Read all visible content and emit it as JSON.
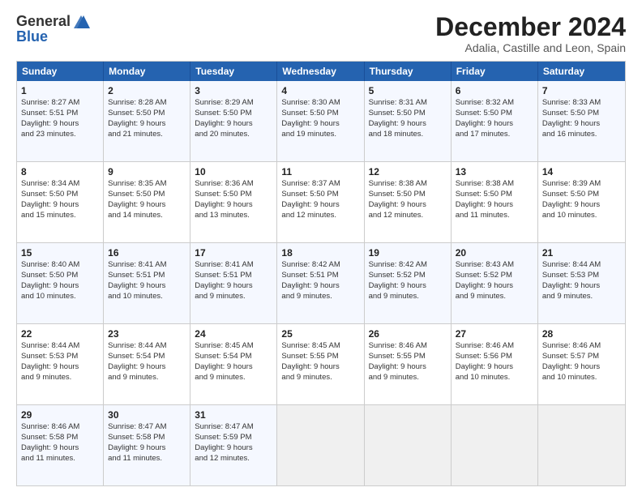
{
  "logo": {
    "general": "General",
    "blue": "Blue"
  },
  "title": "December 2024",
  "subtitle": "Adalia, Castille and Leon, Spain",
  "header_days": [
    "Sunday",
    "Monday",
    "Tuesday",
    "Wednesday",
    "Thursday",
    "Friday",
    "Saturday"
  ],
  "weeks": [
    [
      {
        "day": "1",
        "lines": [
          "Sunrise: 8:27 AM",
          "Sunset: 5:51 PM",
          "Daylight: 9 hours",
          "and 23 minutes."
        ]
      },
      {
        "day": "2",
        "lines": [
          "Sunrise: 8:28 AM",
          "Sunset: 5:50 PM",
          "Daylight: 9 hours",
          "and 21 minutes."
        ]
      },
      {
        "day": "3",
        "lines": [
          "Sunrise: 8:29 AM",
          "Sunset: 5:50 PM",
          "Daylight: 9 hours",
          "and 20 minutes."
        ]
      },
      {
        "day": "4",
        "lines": [
          "Sunrise: 8:30 AM",
          "Sunset: 5:50 PM",
          "Daylight: 9 hours",
          "and 19 minutes."
        ]
      },
      {
        "day": "5",
        "lines": [
          "Sunrise: 8:31 AM",
          "Sunset: 5:50 PM",
          "Daylight: 9 hours",
          "and 18 minutes."
        ]
      },
      {
        "day": "6",
        "lines": [
          "Sunrise: 8:32 AM",
          "Sunset: 5:50 PM",
          "Daylight: 9 hours",
          "and 17 minutes."
        ]
      },
      {
        "day": "7",
        "lines": [
          "Sunrise: 8:33 AM",
          "Sunset: 5:50 PM",
          "Daylight: 9 hours",
          "and 16 minutes."
        ]
      }
    ],
    [
      {
        "day": "8",
        "lines": [
          "Sunrise: 8:34 AM",
          "Sunset: 5:50 PM",
          "Daylight: 9 hours",
          "and 15 minutes."
        ]
      },
      {
        "day": "9",
        "lines": [
          "Sunrise: 8:35 AM",
          "Sunset: 5:50 PM",
          "Daylight: 9 hours",
          "and 14 minutes."
        ]
      },
      {
        "day": "10",
        "lines": [
          "Sunrise: 8:36 AM",
          "Sunset: 5:50 PM",
          "Daylight: 9 hours",
          "and 13 minutes."
        ]
      },
      {
        "day": "11",
        "lines": [
          "Sunrise: 8:37 AM",
          "Sunset: 5:50 PM",
          "Daylight: 9 hours",
          "and 12 minutes."
        ]
      },
      {
        "day": "12",
        "lines": [
          "Sunrise: 8:38 AM",
          "Sunset: 5:50 PM",
          "Daylight: 9 hours",
          "and 12 minutes."
        ]
      },
      {
        "day": "13",
        "lines": [
          "Sunrise: 8:38 AM",
          "Sunset: 5:50 PM",
          "Daylight: 9 hours",
          "and 11 minutes."
        ]
      },
      {
        "day": "14",
        "lines": [
          "Sunrise: 8:39 AM",
          "Sunset: 5:50 PM",
          "Daylight: 9 hours",
          "and 10 minutes."
        ]
      }
    ],
    [
      {
        "day": "15",
        "lines": [
          "Sunrise: 8:40 AM",
          "Sunset: 5:50 PM",
          "Daylight: 9 hours",
          "and 10 minutes."
        ]
      },
      {
        "day": "16",
        "lines": [
          "Sunrise: 8:41 AM",
          "Sunset: 5:51 PM",
          "Daylight: 9 hours",
          "and 10 minutes."
        ]
      },
      {
        "day": "17",
        "lines": [
          "Sunrise: 8:41 AM",
          "Sunset: 5:51 PM",
          "Daylight: 9 hours",
          "and 9 minutes."
        ]
      },
      {
        "day": "18",
        "lines": [
          "Sunrise: 8:42 AM",
          "Sunset: 5:51 PM",
          "Daylight: 9 hours",
          "and 9 minutes."
        ]
      },
      {
        "day": "19",
        "lines": [
          "Sunrise: 8:42 AM",
          "Sunset: 5:52 PM",
          "Daylight: 9 hours",
          "and 9 minutes."
        ]
      },
      {
        "day": "20",
        "lines": [
          "Sunrise: 8:43 AM",
          "Sunset: 5:52 PM",
          "Daylight: 9 hours",
          "and 9 minutes."
        ]
      },
      {
        "day": "21",
        "lines": [
          "Sunrise: 8:44 AM",
          "Sunset: 5:53 PM",
          "Daylight: 9 hours",
          "and 9 minutes."
        ]
      }
    ],
    [
      {
        "day": "22",
        "lines": [
          "Sunrise: 8:44 AM",
          "Sunset: 5:53 PM",
          "Daylight: 9 hours",
          "and 9 minutes."
        ]
      },
      {
        "day": "23",
        "lines": [
          "Sunrise: 8:44 AM",
          "Sunset: 5:54 PM",
          "Daylight: 9 hours",
          "and 9 minutes."
        ]
      },
      {
        "day": "24",
        "lines": [
          "Sunrise: 8:45 AM",
          "Sunset: 5:54 PM",
          "Daylight: 9 hours",
          "and 9 minutes."
        ]
      },
      {
        "day": "25",
        "lines": [
          "Sunrise: 8:45 AM",
          "Sunset: 5:55 PM",
          "Daylight: 9 hours",
          "and 9 minutes."
        ]
      },
      {
        "day": "26",
        "lines": [
          "Sunrise: 8:46 AM",
          "Sunset: 5:55 PM",
          "Daylight: 9 hours",
          "and 9 minutes."
        ]
      },
      {
        "day": "27",
        "lines": [
          "Sunrise: 8:46 AM",
          "Sunset: 5:56 PM",
          "Daylight: 9 hours",
          "and 10 minutes."
        ]
      },
      {
        "day": "28",
        "lines": [
          "Sunrise: 8:46 AM",
          "Sunset: 5:57 PM",
          "Daylight: 9 hours",
          "and 10 minutes."
        ]
      }
    ],
    [
      {
        "day": "29",
        "lines": [
          "Sunrise: 8:46 AM",
          "Sunset: 5:58 PM",
          "Daylight: 9 hours",
          "and 11 minutes."
        ]
      },
      {
        "day": "30",
        "lines": [
          "Sunrise: 8:47 AM",
          "Sunset: 5:58 PM",
          "Daylight: 9 hours",
          "and 11 minutes."
        ]
      },
      {
        "day": "31",
        "lines": [
          "Sunrise: 8:47 AM",
          "Sunset: 5:59 PM",
          "Daylight: 9 hours",
          "and 12 minutes."
        ]
      },
      {
        "day": "",
        "lines": []
      },
      {
        "day": "",
        "lines": []
      },
      {
        "day": "",
        "lines": []
      },
      {
        "day": "",
        "lines": []
      }
    ]
  ]
}
